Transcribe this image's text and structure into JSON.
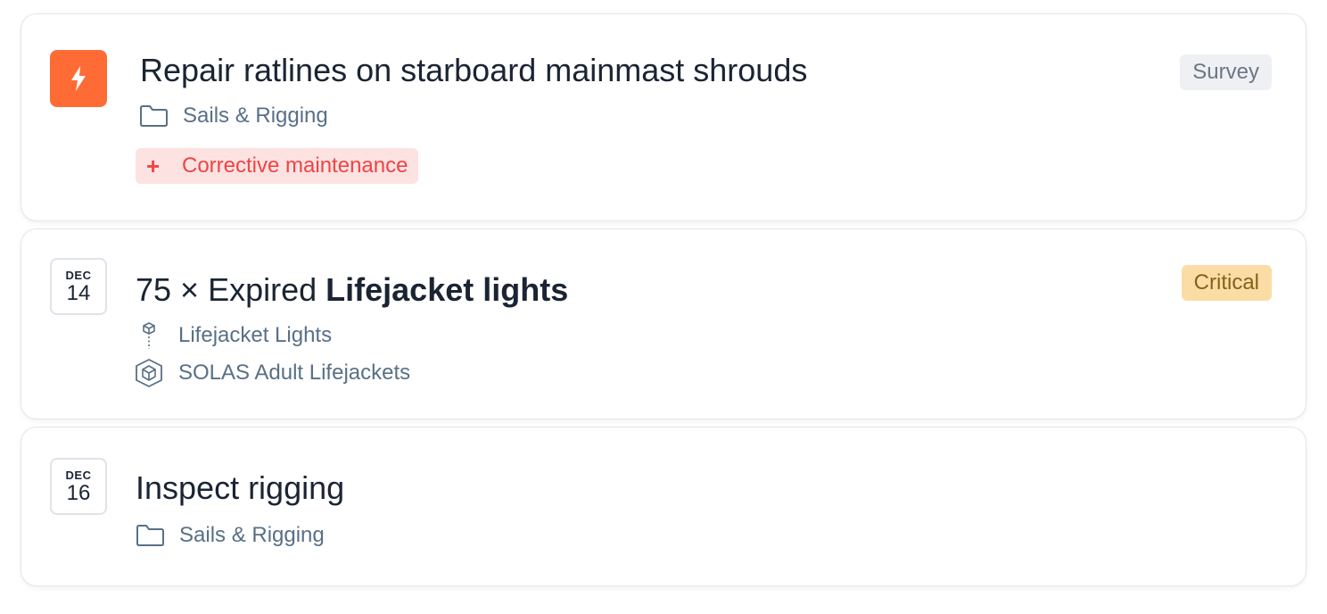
{
  "cards": [
    {
      "title": "Repair ratlines on starboard mainmast shrouds",
      "lead_icon": "lightning-icon",
      "category": "Sails & Rigging",
      "tag": "Corrective maintenance",
      "badge": "Survey"
    },
    {
      "date": {
        "month": "DEC",
        "day": "14"
      },
      "title_prefix": "75 × Expired ",
      "title_bold": "Lifejacket lights",
      "item": "Lifejacket Lights",
      "parent": "SOLAS Adult Lifejackets",
      "badge": "Critical"
    },
    {
      "date": {
        "month": "DEC",
        "day": "16"
      },
      "title": "Inspect rigging",
      "category": "Sails & Rigging"
    }
  ],
  "colors": {
    "lead_icon_bg": "#ff6b35",
    "tag_bg": "#fde2e2",
    "tag_text": "#ef4444",
    "badge_survey_bg": "#eef0f3",
    "badge_critical_bg": "#fbdca4",
    "meta_text": "#587086"
  }
}
